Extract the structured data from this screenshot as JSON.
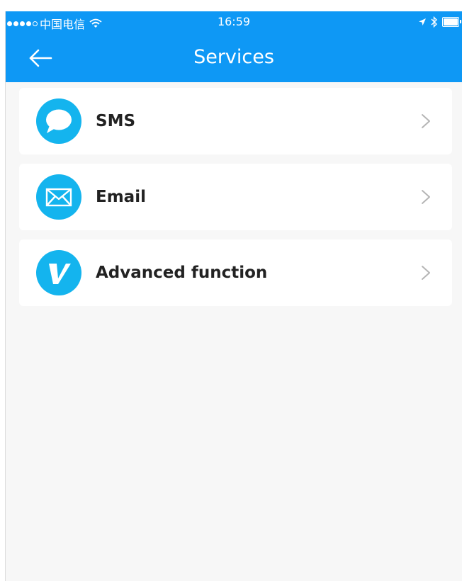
{
  "status_bar": {
    "carrier": "中国电信",
    "time": "16:59",
    "signal_bars_filled": 4,
    "signal_bars_total": 5
  },
  "header": {
    "title": "Services"
  },
  "services": [
    {
      "label": "SMS",
      "icon": "chat-bubble-icon"
    },
    {
      "label": "Email",
      "icon": "envelope-icon"
    },
    {
      "label": "Advanced function",
      "icon": "v-badge-icon"
    }
  ],
  "colors": {
    "header": "#0e98f5",
    "icon_circle": "#14b4ee",
    "background": "#f7f7f7",
    "card": "#ffffff",
    "chevron": "#b5b5b5"
  }
}
